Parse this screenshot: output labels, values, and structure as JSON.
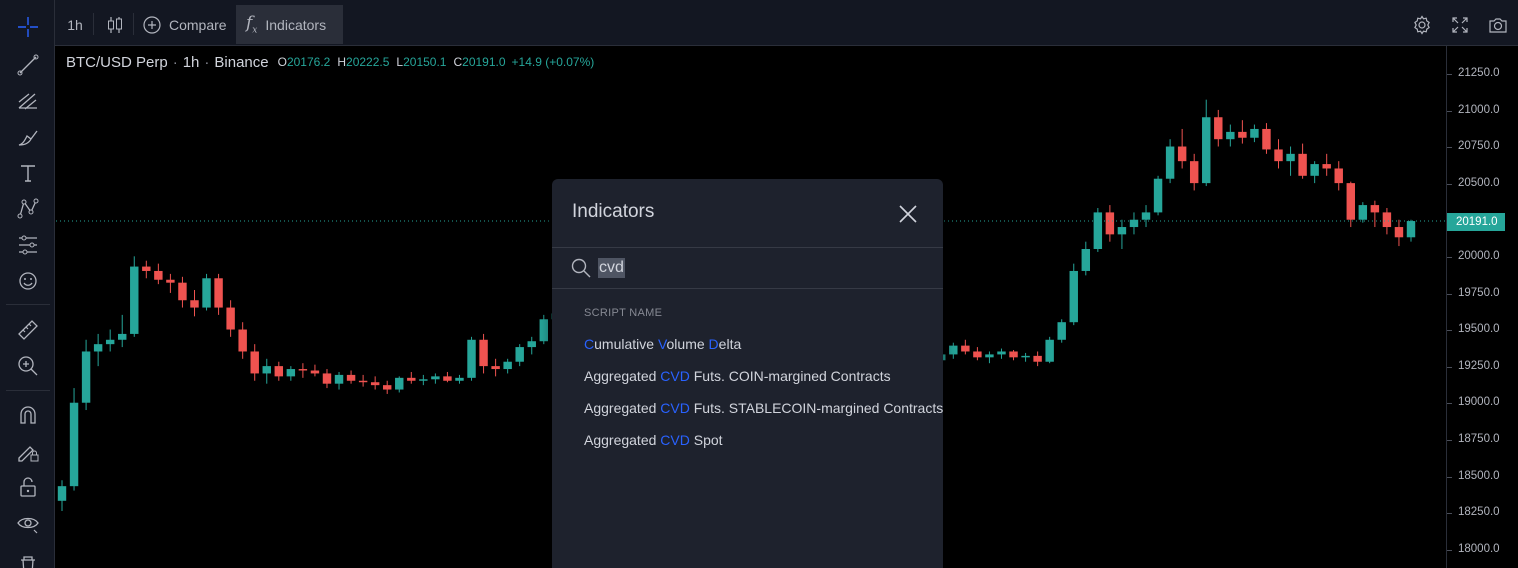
{
  "top_toolbar": {
    "interval": "1h",
    "compare_label": "Compare",
    "indicators_label": "Indicators"
  },
  "legend": {
    "symbol": "BTC/USD Perp",
    "interval": "1h",
    "exchange": "Binance",
    "open_key": "O",
    "open": "20176.2",
    "high_key": "H",
    "high": "20222.5",
    "low_key": "L",
    "low": "20150.1",
    "close_key": "C",
    "close": "20191.0",
    "change": "+14.9 (+0.07%)"
  },
  "price_axis": {
    "ticks": [
      "21250.0",
      "21000.0",
      "20750.0",
      "20500.0",
      "20250.0",
      "20000.0",
      "19750.0",
      "19500.0",
      "19250.0",
      "19000.0",
      "18750.0",
      "18500.0",
      "18250.0",
      "18000.0"
    ],
    "last_price": "20191.0"
  },
  "colors": {
    "up": "#26a69a",
    "down": "#ef5350",
    "accent": "#2962ff"
  },
  "dialog": {
    "title": "Indicators",
    "search_value": "cvd",
    "column_header": "SCRIPT NAME",
    "results": [
      {
        "parts": [
          {
            "t": "C",
            "hl": true
          },
          {
            "t": "umulative ",
            "hl": false
          },
          {
            "t": "V",
            "hl": true
          },
          {
            "t": "olume ",
            "hl": false
          },
          {
            "t": "D",
            "hl": true
          },
          {
            "t": "elta",
            "hl": false
          }
        ]
      },
      {
        "parts": [
          {
            "t": "Aggregated ",
            "hl": false
          },
          {
            "t": "CVD",
            "hl": true
          },
          {
            "t": " Futs. COIN-margined Contracts",
            "hl": false
          }
        ]
      },
      {
        "parts": [
          {
            "t": "Aggregated ",
            "hl": false
          },
          {
            "t": "CVD",
            "hl": true
          },
          {
            "t": " Futs. STABLECOIN-margined Contracts",
            "hl": false
          }
        ]
      },
      {
        "parts": [
          {
            "t": "Aggregated ",
            "hl": false
          },
          {
            "t": "CVD",
            "hl": true
          },
          {
            "t": " Spot",
            "hl": false
          }
        ]
      }
    ]
  },
  "chart_data": {
    "type": "candlestick",
    "interval": "1h",
    "ylim": [
      17875,
      21375
    ],
    "candles": [
      [
        18280,
        18420,
        18210,
        18380
      ],
      [
        18380,
        19050,
        18350,
        18950
      ],
      [
        18950,
        19380,
        18900,
        19300
      ],
      [
        19300,
        19420,
        19200,
        19350
      ],
      [
        19350,
        19450,
        19300,
        19380
      ],
      [
        19380,
        19550,
        19330,
        19420
      ],
      [
        19420,
        19950,
        19400,
        19880
      ],
      [
        19880,
        19920,
        19800,
        19850
      ],
      [
        19850,
        19900,
        19760,
        19790
      ],
      [
        19790,
        19830,
        19700,
        19770
      ],
      [
        19770,
        19810,
        19600,
        19650
      ],
      [
        19650,
        19720,
        19540,
        19600
      ],
      [
        19600,
        19830,
        19580,
        19800
      ],
      [
        19800,
        19830,
        19550,
        19600
      ],
      [
        19600,
        19650,
        19400,
        19450
      ],
      [
        19450,
        19500,
        19250,
        19300
      ],
      [
        19300,
        19350,
        19100,
        19150
      ],
      [
        19150,
        19250,
        19080,
        19200
      ],
      [
        19200,
        19230,
        19100,
        19130
      ],
      [
        19130,
        19200,
        19100,
        19180
      ],
      [
        19180,
        19220,
        19120,
        19170
      ],
      [
        19170,
        19210,
        19130,
        19150
      ],
      [
        19150,
        19180,
        19050,
        19080
      ],
      [
        19080,
        19160,
        19040,
        19140
      ],
      [
        19140,
        19170,
        19080,
        19100
      ],
      [
        19100,
        19140,
        19060,
        19090
      ],
      [
        19090,
        19130,
        19040,
        19070
      ],
      [
        19070,
        19100,
        19010,
        19040
      ],
      [
        19040,
        19130,
        19020,
        19120
      ],
      [
        19120,
        19160,
        19080,
        19100
      ],
      [
        19100,
        19140,
        19070,
        19110
      ],
      [
        19110,
        19150,
        19080,
        19130
      ],
      [
        19130,
        19160,
        19090,
        19100
      ],
      [
        19100,
        19140,
        19080,
        19120
      ],
      [
        19120,
        19400,
        19100,
        19380
      ],
      [
        19380,
        19420,
        19150,
        19200
      ],
      [
        19200,
        19250,
        19130,
        19180
      ],
      [
        19180,
        19250,
        19150,
        19230
      ],
      [
        19230,
        19350,
        19200,
        19330
      ],
      [
        19330,
        19400,
        19280,
        19370
      ],
      [
        19370,
        19550,
        19350,
        19520
      ],
      [
        19520,
        19600,
        19480,
        19560
      ],
      [
        19560,
        19590,
        19480,
        19510
      ],
      [
        19510,
        19580,
        19490,
        19550
      ],
      [
        19550,
        19590,
        19500,
        19530
      ],
      [
        19530,
        19600,
        19510,
        19580
      ],
      [
        19580,
        19620,
        19530,
        19560
      ],
      [
        19560,
        19700,
        19540,
        19640
      ],
      [
        19640,
        19660,
        19580,
        19600
      ],
      [
        19600,
        19630,
        19480,
        19500
      ],
      [
        19500,
        19520,
        19250,
        19300
      ],
      [
        19300,
        19320,
        19100,
        19180
      ],
      [
        19180,
        19300,
        19150,
        19260
      ],
      [
        19260,
        19280,
        19180,
        19220
      ],
      [
        19220,
        19260,
        19140,
        19180
      ],
      [
        19180,
        19230,
        19160,
        19210
      ],
      [
        19210,
        19240,
        19170,
        19190
      ],
      [
        19190,
        19230,
        19150,
        19170
      ],
      [
        19170,
        19210,
        19150,
        19200
      ],
      [
        19200,
        19220,
        19150,
        19170
      ],
      [
        19170,
        19200,
        19100,
        19130
      ],
      [
        19130,
        19170,
        19100,
        19150
      ],
      [
        19150,
        19520,
        19130,
        19480
      ],
      [
        19480,
        19600,
        19450,
        19560
      ],
      [
        19560,
        19680,
        19500,
        19520
      ],
      [
        19520,
        19560,
        19400,
        19440
      ],
      [
        19440,
        19460,
        19300,
        19340
      ],
      [
        19340,
        19380,
        19260,
        19300
      ],
      [
        19300,
        19340,
        19230,
        19260
      ],
      [
        19260,
        19350,
        19240,
        19330
      ],
      [
        19330,
        19420,
        19300,
        19380
      ],
      [
        19380,
        19400,
        19300,
        19320
      ],
      [
        19320,
        19350,
        19200,
        19240
      ],
      [
        19240,
        19300,
        19140,
        19280
      ],
      [
        19280,
        19360,
        19250,
        19340
      ],
      [
        19340,
        19380,
        19280,
        19300
      ],
      [
        19300,
        19330,
        19240,
        19260
      ],
      [
        19260,
        19300,
        19220,
        19280
      ],
      [
        19280,
        19320,
        19250,
        19300
      ],
      [
        19300,
        19310,
        19240,
        19260
      ],
      [
        19260,
        19290,
        19230,
        19270
      ],
      [
        19270,
        19300,
        19200,
        19230
      ],
      [
        19230,
        19400,
        19220,
        19380
      ],
      [
        19380,
        19520,
        19360,
        19500
      ],
      [
        19500,
        19900,
        19480,
        19850
      ],
      [
        19850,
        20050,
        19820,
        20000
      ],
      [
        20000,
        20280,
        19980,
        20250
      ],
      [
        20250,
        20300,
        20050,
        20100
      ],
      [
        20100,
        20200,
        20000,
        20150
      ],
      [
        20150,
        20250,
        20100,
        20200
      ],
      [
        20200,
        20300,
        20150,
        20250
      ],
      [
        20250,
        20500,
        20230,
        20480
      ],
      [
        20480,
        20750,
        20450,
        20700
      ],
      [
        20700,
        20820,
        20550,
        20600
      ],
      [
        20600,
        20650,
        20400,
        20450
      ],
      [
        20450,
        21020,
        20430,
        20900
      ],
      [
        20900,
        20950,
        20700,
        20750
      ],
      [
        20750,
        20850,
        20700,
        20800
      ],
      [
        20800,
        20880,
        20720,
        20760
      ],
      [
        20760,
        20850,
        20730,
        20820
      ],
      [
        20820,
        20860,
        20650,
        20680
      ],
      [
        20680,
        20750,
        20550,
        20600
      ],
      [
        20600,
        20700,
        20500,
        20650
      ],
      [
        20650,
        20720,
        20480,
        20500
      ],
      [
        20500,
        20600,
        20450,
        20580
      ],
      [
        20580,
        20650,
        20500,
        20550
      ],
      [
        20550,
        20600,
        20400,
        20450
      ],
      [
        20450,
        20460,
        20150,
        20200
      ],
      [
        20200,
        20320,
        20180,
        20300
      ],
      [
        20300,
        20330,
        20150,
        20250
      ],
      [
        20250,
        20280,
        20100,
        20150
      ],
      [
        20150,
        20200,
        20020,
        20080
      ],
      [
        20080,
        20200,
        20050,
        20191
      ]
    ]
  }
}
